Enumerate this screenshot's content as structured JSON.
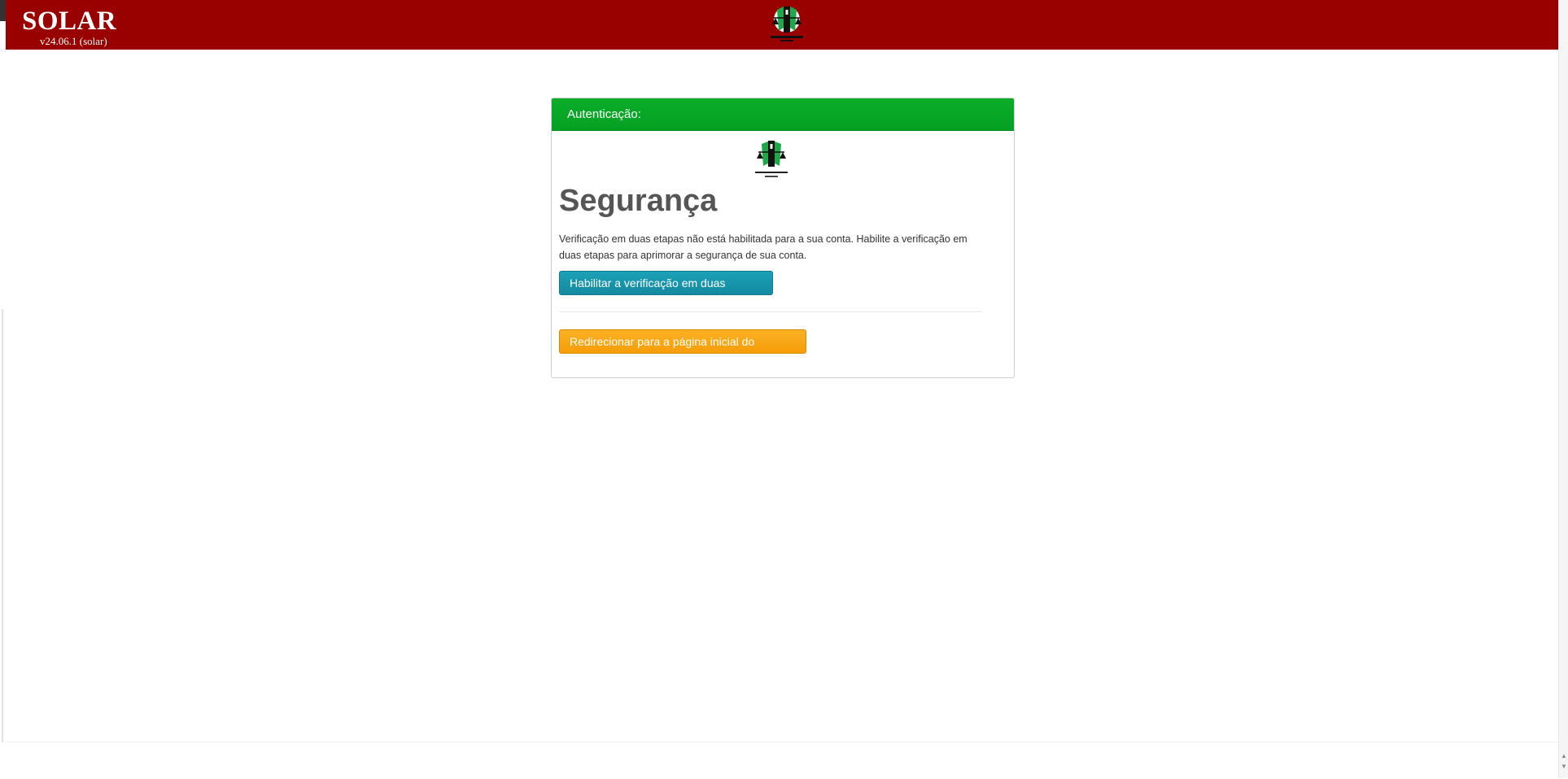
{
  "header": {
    "brand": "SOLAR",
    "version": "v24.06.1 (solar)",
    "background_color": "#990000"
  },
  "panel": {
    "header_title": "Autenticação:",
    "header_color": "#05a022",
    "title": "Segurança",
    "description": "Verificação em duas etapas não está habilitada para a sua conta. Habilite a verificação em duas etapas para aprimorar a segurança de sua conta.",
    "enable_2fa_label": "Habilitar a verificação em duas etapas",
    "redirect_label": "Redirecionar para a página inicial do SOLAR"
  }
}
